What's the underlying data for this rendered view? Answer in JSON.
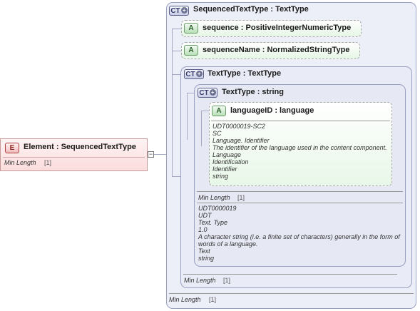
{
  "outer": {
    "badge": "CT",
    "title": "SequencedTextType : TextType",
    "min_label": "Min Length",
    "min_value": "[1]"
  },
  "attributes": [
    {
      "badge": "A",
      "label": "sequence : PositiveIntegerNumericType"
    },
    {
      "badge": "A",
      "label": "sequenceName : NormalizedStringType"
    }
  ],
  "texttype": {
    "badge": "CT",
    "title": "TextType : TextType",
    "min_label": "Min Length",
    "min_value": "[1]"
  },
  "inner": {
    "badge": "CT",
    "title": "TextType : string",
    "min_label": "Min Length",
    "min_value": "[1]",
    "doc": [
      "UDT0000019",
      "UDT",
      "Text. Type",
      "1.0",
      "A character string (i.e. a finite set of characters) generally in the form of",
      "words of a language.",
      "Text",
      "string"
    ]
  },
  "language": {
    "badge": "A",
    "title": "languageID : language",
    "doc": [
      "UDT0000019-SC2",
      "SC",
      "Language. Identifier",
      "The identifier of the language used in the content component.",
      "Language",
      "Identification",
      "Identifier",
      "string"
    ]
  },
  "element": {
    "badge": "E",
    "title": "Element  : SequencedTextType",
    "min_label": "Min Length",
    "min_value": "[1]"
  },
  "colors": {
    "complex_type_fill": "#eceef8",
    "attribute_fill": "#e6f6e6",
    "element_fill": "#fde8e8",
    "connector": "#a5a9c6"
  }
}
